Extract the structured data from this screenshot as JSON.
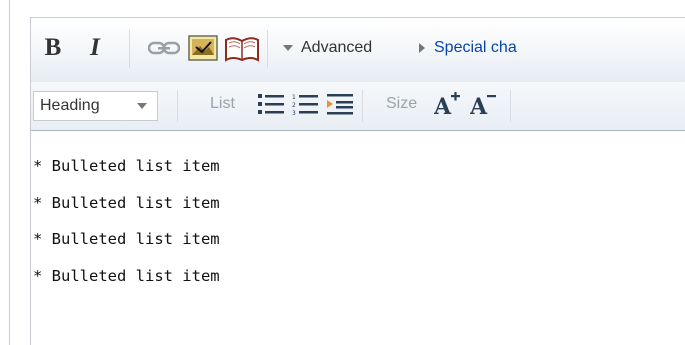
{
  "toolbar": {
    "bold_label": "B",
    "italic_label": "I",
    "advanced_label": "Advanced",
    "special_label": "Special cha",
    "heading_value": "Heading",
    "list_label": "List",
    "size_label": "Size"
  },
  "icons": {
    "link": "link-icon",
    "image": "embedded-file-icon",
    "reference": "reference-book-icon",
    "bulleted": "bulleted-list-icon",
    "numbered": "numbered-list-icon",
    "indent": "indent-icon",
    "bigger": "bigger-text-icon",
    "smaller": "smaller-text-icon"
  },
  "content": {
    "lines": [
      "* Bulleted list item",
      "* Bulleted list item",
      "* Bulleted list item",
      "* Bulleted list item"
    ]
  }
}
